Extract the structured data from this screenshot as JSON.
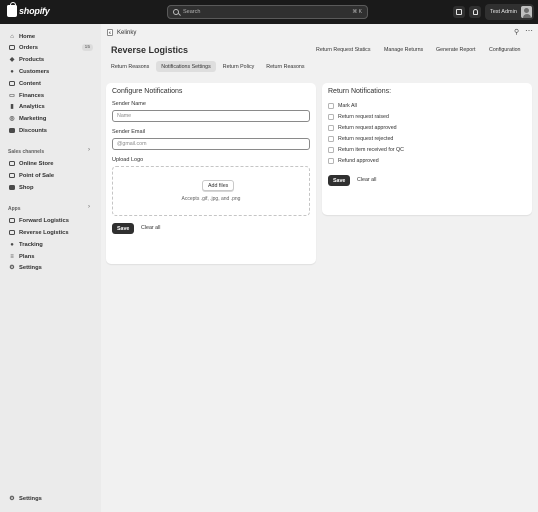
{
  "topbar": {
    "brand": "shopify",
    "search_placeholder": "Search",
    "search_shortcut": "⌘ K",
    "user_name": "Test Admin"
  },
  "sidebar": {
    "items": [
      {
        "label": "Home",
        "icon": "home-icon"
      },
      {
        "label": "Orders",
        "icon": "orders-icon",
        "badge": "15"
      },
      {
        "label": "Products",
        "icon": "tag-icon"
      },
      {
        "label": "Customers",
        "icon": "person-icon"
      },
      {
        "label": "Content",
        "icon": "content-icon"
      },
      {
        "label": "Finances",
        "icon": "bank-icon"
      },
      {
        "label": "Analytics",
        "icon": "chart-icon"
      },
      {
        "label": "Marketing",
        "icon": "target-icon"
      },
      {
        "label": "Discounts",
        "icon": "discount-icon"
      }
    ],
    "sales_channels_label": "Sales channels",
    "sales_channels": [
      {
        "label": "Online Store",
        "icon": "store-icon"
      },
      {
        "label": "Point of Sale",
        "icon": "pos-icon"
      },
      {
        "label": "Shop",
        "icon": "shop-icon"
      }
    ],
    "apps_label": "Apps",
    "apps": [
      {
        "label": "Forward Logistics",
        "icon": "app-icon"
      },
      {
        "label": "Reverse Logistics",
        "icon": "app-icon"
      },
      {
        "label": "Tracking",
        "icon": "pin-icon"
      },
      {
        "label": "Plans",
        "icon": "list-icon"
      },
      {
        "label": "Settings",
        "icon": "gear-icon"
      }
    ],
    "settings_label": "Settings"
  },
  "app_header": {
    "app_name": "Kelinky"
  },
  "page": {
    "title": "Reverse Logistics",
    "header_links": [
      "Return Request Statics",
      "Manage Returns",
      "Generate Report",
      "Configuration"
    ],
    "tabs": [
      "Return Reasons",
      "Notifications Settings",
      "Return Policy",
      "Return Reasons"
    ],
    "active_tab": "Notifications Settings"
  },
  "configure": {
    "title": "Configure Notifications",
    "sender_name_label": "Sender Name",
    "sender_name_placeholder": "Name",
    "sender_email_label": "Sender Email",
    "sender_email_placeholder": "@gmail.com",
    "upload_label": "Upload Logo",
    "add_files": "Add files",
    "accepts": "Accepts .gif, .jpg, and .png",
    "save": "Save",
    "clear": "Clear all"
  },
  "return_notifications": {
    "title": "Return Notifications:",
    "options": [
      "Mark All",
      "Return request raised",
      "Return request approved",
      "Return request rejected",
      "Return item received for QC",
      "Refund approved"
    ],
    "save": "Save",
    "clear": "Clear all"
  }
}
